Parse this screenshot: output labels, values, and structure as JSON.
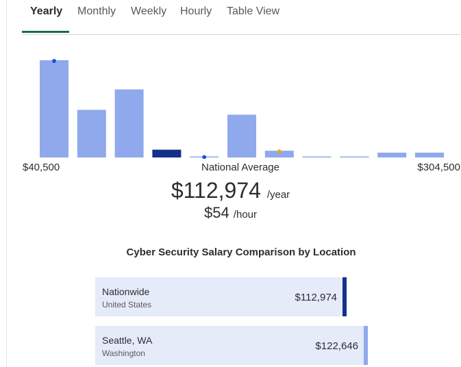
{
  "tabs": [
    {
      "label": "Yearly",
      "active": true
    },
    {
      "label": "Monthly",
      "active": false
    },
    {
      "label": "Weekly",
      "active": false
    },
    {
      "label": "Hourly",
      "active": false
    },
    {
      "label": "Table View",
      "active": false
    }
  ],
  "chart_data": {
    "type": "bar",
    "description_scale": "relative frequency of salaries, lowest to highest bin",
    "values": [
      100,
      49,
      70,
      8,
      1,
      44,
      7,
      1,
      1,
      5,
      5
    ],
    "highlighted_bin_index": 3,
    "markers": [
      {
        "bin_index": 0,
        "color": "#1a56db"
      },
      {
        "bin_index": 4,
        "color": "#1a56db"
      },
      {
        "bin_index": 6,
        "color": "#f5a623"
      }
    ],
    "bar_color": "#90a9ec",
    "highlight_color": "#13318a",
    "x_min_label": "$40,500",
    "x_max_label": "$304,500",
    "mid_label": "National Average"
  },
  "summary": {
    "yearly_value": "$112,974",
    "yearly_unit": "/year",
    "hourly_value": "$54",
    "hourly_unit": "/hour"
  },
  "comparison": {
    "title": "Cyber Security Salary Comparison by Location",
    "locations": [
      {
        "name": "Nationwide",
        "subtitle": "United States",
        "value": "$112,974",
        "bar_color": "#13318a"
      },
      {
        "name": "Seattle, WA",
        "subtitle": "Washington",
        "value": "$122,646",
        "bar_color": "#90a9ec"
      }
    ]
  }
}
